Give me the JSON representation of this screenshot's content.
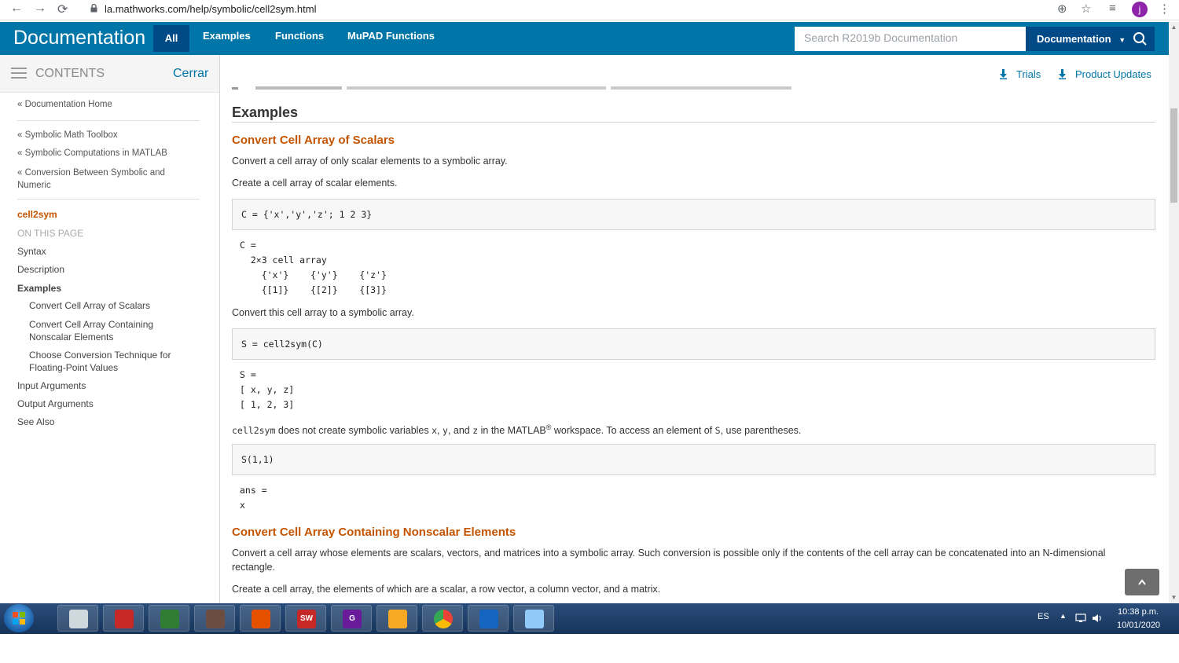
{
  "browser": {
    "url": "la.mathworks.com/help/symbolic/cell2sym.html",
    "profile_initial": "j"
  },
  "header": {
    "brand": "Documentation",
    "tabs": [
      "All",
      "Examples",
      "Functions",
      "MuPAD Functions"
    ],
    "search_placeholder": "Search R2019b Documentation",
    "search_scope": "Documentation"
  },
  "sidebar": {
    "contents_label": "CONTENTS",
    "close_label": "Cerrar",
    "doc_home": "« Documentation Home",
    "breadcrumbs": [
      "« Symbolic Math Toolbox",
      "« Symbolic Computations in MATLAB",
      "« Conversion Between Symbolic and Numeric"
    ],
    "current_page": "cell2sym",
    "on_this_page": "ON THIS PAGE",
    "items": [
      "Syntax",
      "Description",
      "Examples"
    ],
    "sub_items": [
      "Convert Cell Array of Scalars",
      "Convert Cell Array Containing Nonscalar Elements",
      "Choose Conversion Technique for Floating-Point Values"
    ],
    "items_after": [
      "Input Arguments",
      "Output Arguments",
      "See Also"
    ]
  },
  "top_links": {
    "trials": "Trials",
    "product_updates": "Product Updates"
  },
  "content": {
    "h2": "Examples",
    "sec1_title": "Convert Cell Array of Scalars",
    "sec1_p1": "Convert a cell array of only scalar elements to a symbolic array.",
    "sec1_p2": "Create a cell array of scalar elements.",
    "code1": "C = {'x','y','z'; 1 2 3}",
    "out1": "C =\n  2×3 cell array\n    {'x'}    {'y'}    {'z'}\n    {[1]}    {[2]}    {[3]}",
    "sec1_p3": "Convert this cell array to a symbolic array.",
    "code2": "S = cell2sym(C)",
    "out2": "S =\n[ x, y, z]\n[ 1, 2, 3]",
    "p4_fn": "cell2sym",
    "p4_a": " does not create symbolic variables ",
    "p4_x": "x",
    "p4_b": ", ",
    "p4_y": "y",
    "p4_c": ", and ",
    "p4_z": "z",
    "p4_d": " in the MATLAB",
    "p4_reg": "®",
    "p4_e": " workspace. To access an element of ",
    "p4_s": "S",
    "p4_f": ", use parentheses.",
    "code3": "S(1,1)",
    "out3": "ans =\nx",
    "sec2_title": "Convert Cell Array Containing Nonscalar Elements",
    "sec2_p1": "Convert a cell array whose elements are scalars, vectors, and matrices into a symbolic array. Such conversion is possible only if the contents of the cell array can be concatenated into an N-dimensional rectangle.",
    "sec2_p2": "Create a cell array, the elements of which are a scalar, a row vector, a column vector, and a matrix."
  },
  "taskbar": {
    "language": "ES",
    "time": "10:38 p.m.",
    "date": "10/01/2020",
    "apps": [
      {
        "name": "settings-tool",
        "color": "#cfd8dc"
      },
      {
        "name": "autocad",
        "color": "#c62828"
      },
      {
        "name": "geogebra",
        "color": "#2e7d32"
      },
      {
        "name": "paint-tool",
        "color": "#6d4c41"
      },
      {
        "name": "matlab",
        "color": "#e65100"
      },
      {
        "name": "solidworks",
        "label": "SW",
        "color": "#c62828"
      },
      {
        "name": "pdf-tool",
        "label": "G",
        "color": "#6a1b9a"
      },
      {
        "name": "file-explorer",
        "color": "#f9a825"
      },
      {
        "name": "chrome",
        "color": "#ffffff"
      },
      {
        "name": "winrar",
        "color": "#1565c0"
      },
      {
        "name": "notepad",
        "color": "#90caf9"
      }
    ]
  },
  "colors": {
    "brand_blue": "#0076a8",
    "dark_blue": "#004b87",
    "section_orange": "#c45400",
    "current_orange": "#c45400"
  }
}
